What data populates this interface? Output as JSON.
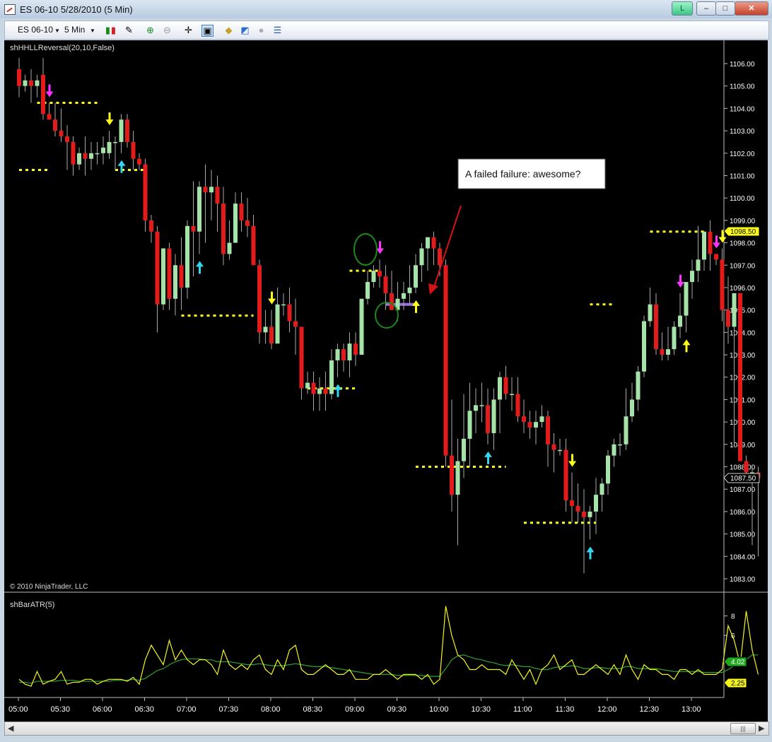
{
  "window": {
    "title": "ES 06-10  5/28/2010 (5 Min)",
    "badge": "L",
    "min": "–",
    "max": "□",
    "close": "✕"
  },
  "toolbar": {
    "instrument": "ES 06-10",
    "interval": "5 Min"
  },
  "main": {
    "indicator_label": "shHHLLReversal(20,10,False)",
    "copyright": "© 2010 NinjaTrader, LLC",
    "annotation": "A failed failure: awesome?",
    "current_price_label": "1087.50",
    "marker_price_label": "1098.50"
  },
  "lower": {
    "indicator_label": "shBarATR(5)",
    "atr_label": "4.02",
    "atr2_label": "2.25"
  },
  "colors": {
    "up": "#a6e3a8",
    "down": "#e31b1b",
    "swing": "#ffff1a",
    "pink": "#ff33ff",
    "cyan": "#33d6f0",
    "atr": "#f4f41c",
    "atr_avg": "#2fa32f"
  },
  "chart_data": {
    "type": "candlestick",
    "price_axis": {
      "min": 1083,
      "max": 1106,
      "ticks": [
        1106,
        1105,
        1104,
        1103,
        1102,
        1101,
        1100,
        1099,
        1098,
        1097,
        1096,
        1095,
        1094,
        1093,
        1092,
        1091,
        1090,
        1089,
        1088,
        1087,
        1086,
        1085,
        1084,
        1083
      ],
      "tick_labels": [
        "1106.00",
        "1105.00",
        "1104.00",
        "1103.00",
        "1102.00",
        "1101.00",
        "1100.00",
        "1099.00",
        "1098.00",
        "1097.00",
        "1096.00",
        "1095.00",
        "1094.00",
        "1093.00",
        "1092.00",
        "1091.00",
        "1090.00",
        "1089.00",
        "1088.00",
        "1087.00",
        "1086.00",
        "1085.00",
        "1084.00",
        "1083.00"
      ]
    },
    "time_axis": {
      "labels": [
        "05:00",
        "05:30",
        "06:00",
        "06:30",
        "07:00",
        "07:30",
        "08:00",
        "08:30",
        "09:00",
        "09:30",
        "10:00",
        "10:30",
        "11:00",
        "11:30",
        "12:00",
        "12:30",
        "13:00"
      ]
    },
    "ohlc": [
      [
        1105.75,
        1106.25,
        1104.5,
        1105
      ],
      [
        1105,
        1105.5,
        1104.75,
        1105.25
      ],
      [
        1105.25,
        1105.75,
        1104.25,
        1105
      ],
      [
        1105,
        1105.5,
        1104.5,
        1105.25
      ],
      [
        1105.5,
        1106.25,
        1103.5,
        1103.75
      ],
      [
        1103.75,
        1104.25,
        1103.5,
        1103.5
      ],
      [
        1103.5,
        1104.25,
        1102.75,
        1103
      ],
      [
        1103,
        1104,
        1102.5,
        1102.75
      ],
      [
        1102.75,
        1103.25,
        1101.25,
        1102.5
      ],
      [
        1102.5,
        1102.75,
        1101,
        1101.5
      ],
      [
        1101.5,
        1102.25,
        1101.25,
        1102
      ],
      [
        1102,
        1102.75,
        1101,
        1101.75
      ],
      [
        1101.75,
        1102.5,
        1101.25,
        1102
      ],
      [
        1102,
        1102.5,
        1101.5,
        1102
      ],
      [
        1102,
        1102.75,
        1101.5,
        1102.25
      ],
      [
        1102,
        1103,
        1101.75,
        1102.5
      ],
      [
        1102.5,
        1102.75,
        1101.25,
        1102.5
      ],
      [
        1102.5,
        1103.75,
        1102,
        1103.5
      ],
      [
        1103.5,
        1103.75,
        1102.25,
        1102.5
      ],
      [
        1102.5,
        1103,
        1101.25,
        1101.75
      ],
      [
        1101.75,
        1102,
        1101.25,
        1101.5
      ],
      [
        1101.5,
        1101.75,
        1098.5,
        1099
      ],
      [
        1099,
        1099.25,
        1098,
        1098.5
      ],
      [
        1098.5,
        1098.75,
        1094,
        1095.25
      ],
      [
        1095.25,
        1097.75,
        1095,
        1097.75
      ],
      [
        1097.75,
        1098,
        1095,
        1095.5
      ],
      [
        1095.5,
        1097.5,
        1094.75,
        1097
      ],
      [
        1097,
        1098.25,
        1095,
        1096
      ],
      [
        1096,
        1099,
        1095.5,
        1098.75
      ],
      [
        1098.75,
        1100.75,
        1096.5,
        1098.5
      ],
      [
        1098.5,
        1100.75,
        1097.5,
        1100.5
      ],
      [
        1100.5,
        1101.5,
        1098,
        1100.25
      ],
      [
        1100.25,
        1101.25,
        1099,
        1100.5
      ],
      [
        1100.5,
        1101,
        1098.5,
        1099.75
      ],
      [
        1099.75,
        1100.5,
        1097,
        1097.5
      ],
      [
        1097.5,
        1099,
        1097.25,
        1098
      ],
      [
        1098,
        1100.25,
        1098,
        1099.75
      ],
      [
        1099.75,
        1100.25,
        1098.5,
        1099
      ],
      [
        1099,
        1100,
        1098.25,
        1098.75
      ],
      [
        1098.75,
        1099.25,
        1097,
        1097
      ],
      [
        1097,
        1097.25,
        1093.5,
        1094
      ],
      [
        1094,
        1095,
        1093.5,
        1094.25
      ],
      [
        1094.25,
        1095,
        1093.25,
        1093.5
      ],
      [
        1093.5,
        1096,
        1093.5,
        1095.25
      ],
      [
        1095.25,
        1095.75,
        1094.75,
        1095.25
      ],
      [
        1095.25,
        1096,
        1094,
        1094.5
      ],
      [
        1094.5,
        1095.5,
        1093,
        1094.25
      ],
      [
        1094.25,
        1094.25,
        1091,
        1091.5
      ],
      [
        1091.5,
        1092.25,
        1091.25,
        1091.75
      ],
      [
        1091.75,
        1092.25,
        1090.5,
        1091.25
      ],
      [
        1091.25,
        1092,
        1090.5,
        1091.5
      ],
      [
        1091.5,
        1092.25,
        1090.5,
        1091.25
      ],
      [
        1091.25,
        1093.25,
        1091,
        1092.75
      ],
      [
        1092.75,
        1093.5,
        1092,
        1093.25
      ],
      [
        1093.25,
        1093.5,
        1092.25,
        1092.75
      ],
      [
        1092.75,
        1094,
        1092,
        1093.5
      ],
      [
        1093.5,
        1094,
        1092.5,
        1093
      ],
      [
        1093,
        1095.5,
        1093,
        1095.5
      ],
      [
        1095.5,
        1096.75,
        1095.25,
        1096.25
      ],
      [
        1096.25,
        1097,
        1096,
        1096.75
      ],
      [
        1096.75,
        1097.25,
        1096,
        1096.5
      ],
      [
        1096.5,
        1097,
        1095,
        1095.75
      ],
      [
        1095.75,
        1096.75,
        1095.25,
        1095
      ],
      [
        1095,
        1096.25,
        1094.5,
        1095.5
      ],
      [
        1095.5,
        1096.25,
        1095,
        1095.75
      ],
      [
        1095.75,
        1097,
        1095.25,
        1096
      ],
      [
        1096,
        1097.5,
        1095.75,
        1097
      ],
      [
        1097,
        1098,
        1096.25,
        1097.75
      ],
      [
        1097.75,
        1098,
        1096.75,
        1098.25
      ],
      [
        1098.25,
        1098.5,
        1097,
        1097.75
      ],
      [
        1097.75,
        1098,
        1096.5,
        1097
      ],
      [
        1097,
        1097.25,
        1088,
        1088.5
      ],
      [
        1088.5,
        1091,
        1086,
        1086.75
      ],
      [
        1086.75,
        1089.25,
        1084.5,
        1088.25
      ],
      [
        1088.25,
        1091.25,
        1087.5,
        1089.25
      ],
      [
        1089.25,
        1091.75,
        1088,
        1090.5
      ],
      [
        1090.5,
        1091.5,
        1089.5,
        1090.75
      ],
      [
        1090.75,
        1091.75,
        1090,
        1090.75
      ],
      [
        1090.75,
        1091.5,
        1089,
        1089.5
      ],
      [
        1089.5,
        1091.5,
        1088.75,
        1091
      ],
      [
        1091,
        1092.25,
        1089.5,
        1092
      ],
      [
        1092,
        1092.5,
        1091,
        1091.25
      ],
      [
        1091.25,
        1092,
        1090.5,
        1091.25
      ],
      [
        1091.25,
        1092,
        1090,
        1090.25
      ],
      [
        1090.25,
        1091,
        1089.5,
        1090
      ],
      [
        1090,
        1090.5,
        1089.25,
        1089.75
      ],
      [
        1089.75,
        1090.5,
        1089,
        1090
      ],
      [
        1090,
        1090.75,
        1089.75,
        1090.25
      ],
      [
        1090.25,
        1090.5,
        1088,
        1089
      ],
      [
        1089,
        1089.5,
        1087.75,
        1088.75
      ],
      [
        1088.75,
        1089.25,
        1088.5,
        1088.75
      ],
      [
        1088.75,
        1089.25,
        1086,
        1086.5
      ],
      [
        1086.5,
        1087.75,
        1085.5,
        1086.25
      ],
      [
        1086.25,
        1087.25,
        1085.5,
        1086
      ],
      [
        1086,
        1087,
        1083.25,
        1085.75
      ],
      [
        1085.75,
        1086.25,
        1084.75,
        1086
      ],
      [
        1086,
        1087.5,
        1085,
        1086.75
      ],
      [
        1086.75,
        1087.5,
        1086,
        1087.25
      ],
      [
        1087.25,
        1088.75,
        1086.75,
        1088.5
      ],
      [
        1088.5,
        1089.25,
        1088,
        1089
      ],
      [
        1089,
        1089.5,
        1088.5,
        1089
      ],
      [
        1089,
        1091.5,
        1088.75,
        1090.25
      ],
      [
        1090.25,
        1091.75,
        1090,
        1091
      ],
      [
        1091,
        1092.5,
        1090.5,
        1092.25
      ],
      [
        1092.25,
        1094.75,
        1092,
        1094.5
      ],
      [
        1094.5,
        1096,
        1094.25,
        1095.25
      ],
      [
        1095.25,
        1095.75,
        1093,
        1093.25
      ],
      [
        1093.25,
        1094,
        1092.75,
        1093
      ],
      [
        1093,
        1094.25,
        1092.75,
        1093.25
      ],
      [
        1093.25,
        1094.5,
        1093,
        1094.25
      ],
      [
        1094.25,
        1095.75,
        1093.75,
        1094.75
      ],
      [
        1094.75,
        1096.25,
        1094,
        1096.25
      ],
      [
        1096.25,
        1097.25,
        1095.5,
        1096.75
      ],
      [
        1096.75,
        1098.75,
        1096.25,
        1097.25
      ],
      [
        1097.25,
        1098.5,
        1096.75,
        1098.5
      ],
      [
        1098.5,
        1099,
        1096.75,
        1097.5
      ],
      [
        1097.5,
        1097.5,
        1097,
        1097.25
      ],
      [
        1097.25,
        1097.75,
        1094.5,
        1095
      ],
      [
        1095,
        1096.5,
        1093.5,
        1094.25
      ],
      [
        1094.25,
        1094.5,
        1089,
        1095.75
      ],
      [
        1095.75,
        1095.75,
        1089.5,
        1088.25
      ],
      [
        1088.25,
        1088.5,
        1087.5,
        1087.75
      ],
      [
        1087.75,
        1088,
        1084.5,
        1087.75
      ],
      [
        1087.75,
        1088,
        1084,
        1087.5
      ]
    ],
    "swing_lines": [
      {
        "price": 1104.25,
        "from_bar": 3,
        "to_bar": 13
      },
      {
        "price": 1101.25,
        "from_bar": 0,
        "to_bar": 5
      },
      {
        "price": 1101.25,
        "from_bar": 16,
        "to_bar": 21
      },
      {
        "price": 1094.75,
        "from_bar": 27,
        "to_bar": 39
      },
      {
        "price": 1091.5,
        "from_bar": 48,
        "to_bar": 56
      },
      {
        "price": 1096.75,
        "from_bar": 55,
        "to_bar": 60
      },
      {
        "price": 1088,
        "from_bar": 66,
        "to_bar": 81
      },
      {
        "price": 1085.5,
        "from_bar": 84,
        "to_bar": 96
      },
      {
        "price": 1095.25,
        "from_bar": 95,
        "to_bar": 99
      },
      {
        "price": 1098.5,
        "from_bar": 105,
        "to_bar": 114
      }
    ],
    "purple_line": {
      "price": 1095.25,
      "from_bar": 61,
      "to_bar": 66
    },
    "atr_axis": {
      "ticks": [
        8,
        6
      ],
      "min": 0,
      "max": 10
    },
    "atr": [
      1.5,
      1.0,
      0.8,
      2.3,
      1.0,
      1.3,
      1.5,
      2.3,
      1.0,
      1.2,
      1.2,
      1.5,
      1.5,
      1.0,
      1.3,
      1.5,
      1.5,
      1.5,
      1.3,
      1.7,
      1.0,
      3.5,
      5.0,
      4.0,
      3.0,
      5.5,
      3.5,
      4.5,
      3.5,
      3.0,
      3.5,
      3.5,
      3.0,
      2.0,
      4.5,
      3.0,
      2.5,
      3.0,
      2.5,
      3.5,
      4.0,
      2.5,
      2.0,
      3.5,
      2.5,
      4.5,
      5.0,
      2.5,
      2.0,
      2.0,
      2.5,
      3.0,
      2.5,
      2.0,
      2.0,
      2.5,
      1.5,
      1.5,
      1.5,
      2.0,
      2.0,
      2.5,
      2.0,
      1.5,
      2.0,
      2.0,
      2.0,
      1.5,
      2.0,
      1.0,
      1.5,
      9.0,
      6.0,
      4.0,
      3.5,
      2.5,
      2.5,
      3.0,
      2.5,
      2.5,
      2.5,
      2.0,
      3.5,
      2.5,
      1.5,
      2.5,
      1.0,
      2.5,
      3.0,
      4.0,
      2.5,
      3.0,
      3.5,
      2.0,
      2.0,
      2.5,
      3.0,
      2.5,
      2.0,
      3.0,
      2.0,
      4.0,
      2.5,
      1.5,
      3.0,
      2.5,
      2.5,
      2.0,
      2.0,
      1.5,
      2.5,
      2.5,
      2.0,
      2.5,
      2.0,
      2.0,
      2.0,
      2.5,
      7.0,
      5.5,
      3.0,
      8.5,
      4.5,
      2.0
    ],
    "atr_avg": [
      1.2,
      1.2,
      1.1,
      1.3,
      1.3,
      1.3,
      1.3,
      1.4,
      1.4,
      1.4,
      1.3,
      1.3,
      1.3,
      1.3,
      1.3,
      1.3,
      1.4,
      1.4,
      1.4,
      1.5,
      1.4,
      1.6,
      2.0,
      2.4,
      2.6,
      3.0,
      3.3,
      3.5,
      3.6,
      3.6,
      3.6,
      3.5,
      3.5,
      3.3,
      3.3,
      3.3,
      3.2,
      3.1,
      3.0,
      3.0,
      3.1,
      3.0,
      2.9,
      2.9,
      2.9,
      3.0,
      3.1,
      3.0,
      2.9,
      2.8,
      2.8,
      2.8,
      2.7,
      2.6,
      2.5,
      2.4,
      2.3,
      2.2,
      2.1,
      2.0,
      2.0,
      2.0,
      2.0,
      1.9,
      1.9,
      1.9,
      1.9,
      1.9,
      1.8,
      1.8,
      1.8,
      2.6,
      3.5,
      3.9,
      4.0,
      3.8,
      3.6,
      3.5,
      3.3,
      3.2,
      3.0,
      2.9,
      3.0,
      2.9,
      2.8,
      2.8,
      2.6,
      2.5,
      2.5,
      2.7,
      2.8,
      2.8,
      2.9,
      2.8,
      2.6,
      2.6,
      2.7,
      2.7,
      2.6,
      2.6,
      2.6,
      2.8,
      2.8,
      2.6,
      2.6,
      2.6,
      2.6,
      2.5,
      2.4,
      2.3,
      2.3,
      2.3,
      2.3,
      2.3,
      2.2,
      2.2,
      2.2,
      2.2,
      2.5,
      2.9,
      3.0,
      3.5,
      4.0,
      4.0
    ],
    "pink_arrows": [
      5,
      60,
      110,
      116
    ],
    "yellow_down_arrows": [
      15,
      42,
      92,
      117
    ],
    "cyan_up_arrows": [
      17,
      30,
      53,
      78,
      95
    ],
    "yellow_up_arrows": [
      66,
      111
    ]
  }
}
